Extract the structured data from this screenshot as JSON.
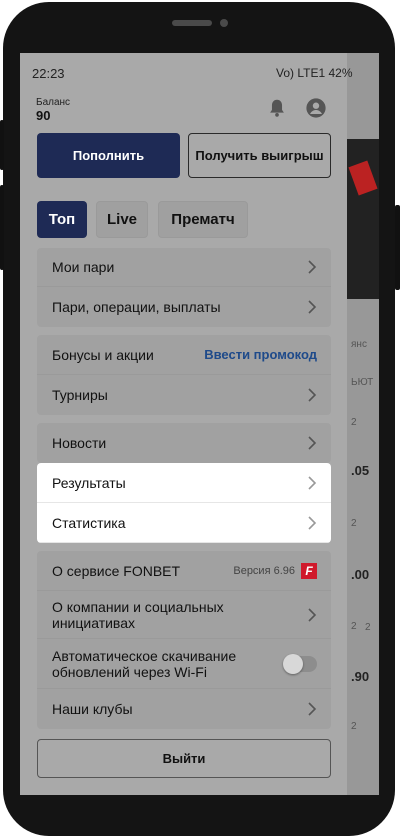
{
  "status_bar": {
    "time": "22:23",
    "icons_text": "Vo) LTE1 42%"
  },
  "background_app": {
    "labels": [
      "янс",
      "ЬЮТ",
      "2",
      ".05",
      "2",
      ".00",
      "2",
      "2",
      ".90",
      "2"
    ]
  },
  "header": {
    "balance_label": "Баланс",
    "balance_value": "90"
  },
  "actions": {
    "deposit": "Пополнить",
    "withdraw": "Получить выигрыш"
  },
  "tabs": [
    {
      "label": "Топ"
    },
    {
      "label": "Live"
    },
    {
      "label": "Прематч"
    }
  ],
  "menu": {
    "g1": [
      "Мои пари",
      "Пари, операции, выплаты"
    ],
    "g2": {
      "bonuses": "Бонусы и акции",
      "promo": "Ввести промокод",
      "tournaments": "Турниры"
    },
    "g3": [
      "Новости"
    ],
    "g4": [
      "Результаты",
      "Статистика"
    ],
    "g5": {
      "about": "О сервисе FONBET",
      "version": "Версия 6.96",
      "logo_letter": "F",
      "company": "О компании и социальных инициативах",
      "autoupdate": "Автоматическое скачивание обновлений через Wi-Fi",
      "clubs": "Наши клубы"
    }
  },
  "logout": "Выйти"
}
